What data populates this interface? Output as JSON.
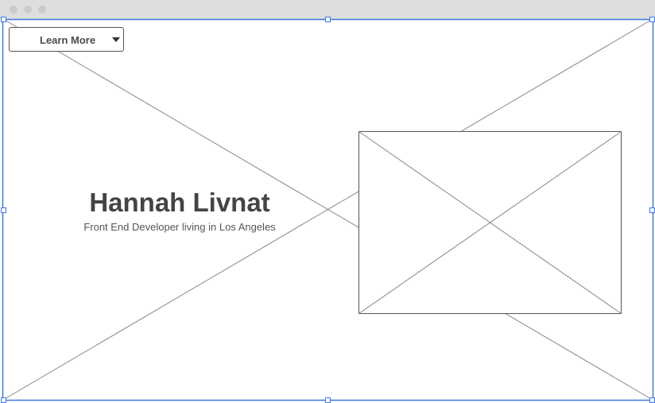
{
  "window": {
    "controls": [
      "close",
      "minimize",
      "maximize"
    ]
  },
  "dropdown": {
    "label": "Learn More",
    "icon": "caret-down-icon"
  },
  "hero": {
    "title": "Hannah Livnat",
    "subtitle": "Front End Developer living in Los Angeles"
  },
  "colors": {
    "selection": "#3a78e0",
    "wire": "#888888",
    "text": "#444444"
  }
}
